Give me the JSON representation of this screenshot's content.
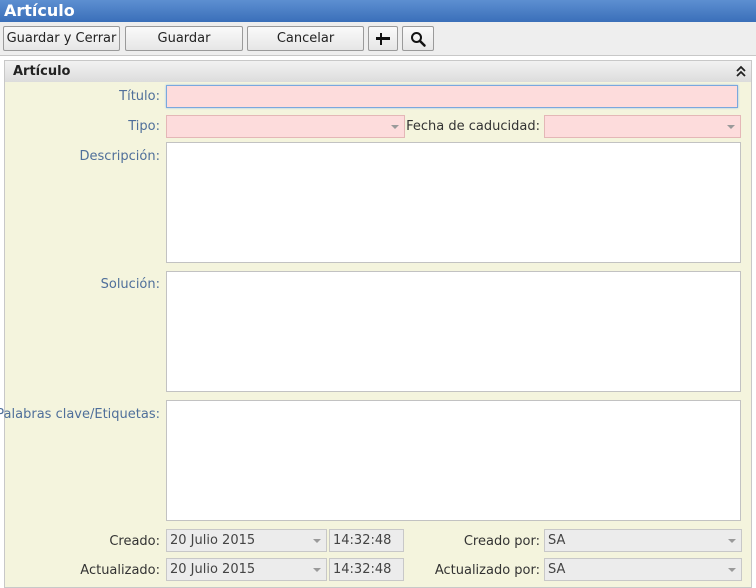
{
  "window": {
    "title": "Artículo"
  },
  "toolbar": {
    "save_close": "Guardar y Cerrar",
    "save": "Guardar",
    "cancel": "Cancelar"
  },
  "panel": {
    "title": "Artículo"
  },
  "form": {
    "titulo_label": "Título:",
    "tipo_label": "Tipo:",
    "fecha_caducidad_label": "Fecha de caducidad:",
    "descripcion_label": "Descripción:",
    "solucion_label": "Solución:",
    "palabras_label": "Palabras clave/Etiquetas:",
    "creado_label": "Creado:",
    "creado_fecha": "20 Julio 2015",
    "creado_hora": "14:32:48",
    "creado_por_label": "Creado por:",
    "creado_por": "SA",
    "actualizado_label": "Actualizado:",
    "actualizado_fecha": "20 Julio 2015",
    "actualizado_hora": "14:32:48",
    "actualizado_por_label": "Actualizado por:",
    "actualizado_por": "SA"
  },
  "icons": {
    "pin": "pin-icon",
    "search": "search-icon",
    "collapse": "double-chevron-up-icon"
  },
  "colors": {
    "title_bar": "#3a6fb9",
    "panel_background": "#f4f4dd",
    "required_field": "#fddcdc",
    "label_text": "#4f6f9a"
  }
}
